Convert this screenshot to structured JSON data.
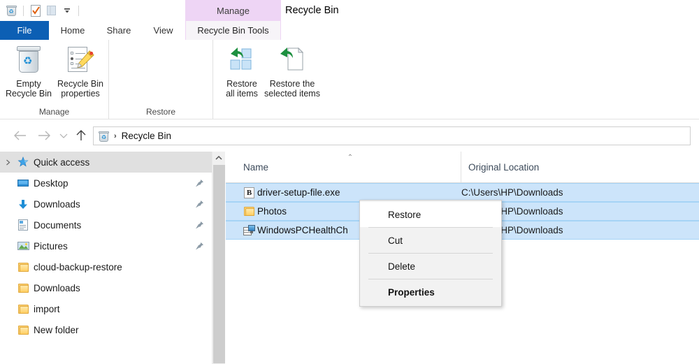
{
  "window": {
    "title": "Recycle Bin",
    "contextual_tab_group": "Manage"
  },
  "quick_access_toolbar": {
    "items": [
      {
        "name": "recycle-bin-icon",
        "label": "Recycle Bin"
      },
      {
        "name": "properties-icon",
        "label": "Properties"
      },
      {
        "name": "new-folder-icon",
        "label": "New folder"
      },
      {
        "name": "customize-dropdown-icon",
        "label": "Customize Quick Access Toolbar"
      }
    ]
  },
  "ribbon": {
    "tabs": [
      {
        "id": "file",
        "label": "File"
      },
      {
        "id": "home",
        "label": "Home"
      },
      {
        "id": "share",
        "label": "Share"
      },
      {
        "id": "view",
        "label": "View"
      },
      {
        "id": "recycle-bin-tools",
        "label": "Recycle Bin Tools"
      }
    ],
    "active_tab": "Recycle Bin Tools",
    "groups": [
      {
        "id": "manage",
        "label": "Manage",
        "buttons": [
          {
            "id": "empty-recycle-bin",
            "line1": "Empty",
            "line2": "Recycle Bin",
            "icon": "recycle-bin-icon"
          },
          {
            "id": "recycle-bin-properties",
            "line1": "Recycle Bin",
            "line2": "properties",
            "icon": "document-pencil-icon"
          }
        ]
      },
      {
        "id": "restore",
        "label": "Restore",
        "buttons": [
          {
            "id": "restore-all-items",
            "line1": "Restore",
            "line2": "all items",
            "icon": "restore-all-icon"
          },
          {
            "id": "restore-selected-items",
            "line1": "Restore the",
            "line2": "selected items",
            "icon": "restore-selected-icon"
          }
        ]
      }
    ]
  },
  "navigation": {
    "back_label": "Back",
    "forward_label": "Forward",
    "recent_label": "Recent locations",
    "up_label": "Up to Desktop",
    "address": {
      "icon": "recycle-bin-icon",
      "separator": "›",
      "crumb": "Recycle Bin"
    }
  },
  "sidebar": {
    "items": [
      {
        "label": "Quick access",
        "icon": "star-pin-icon",
        "selected": true,
        "indent": false,
        "pinned": false
      },
      {
        "label": "Desktop",
        "icon": "desktop-icon",
        "selected": false,
        "indent": true,
        "pinned": true
      },
      {
        "label": "Downloads",
        "icon": "download-icon",
        "selected": false,
        "indent": true,
        "pinned": true
      },
      {
        "label": "Documents",
        "icon": "documents-icon",
        "selected": false,
        "indent": true,
        "pinned": true
      },
      {
        "label": "Pictures",
        "icon": "pictures-icon",
        "selected": false,
        "indent": true,
        "pinned": true
      },
      {
        "label": "cloud-backup-restore",
        "icon": "folder-icon",
        "selected": false,
        "indent": true,
        "pinned": false
      },
      {
        "label": "Downloads",
        "icon": "folder-icon",
        "selected": false,
        "indent": true,
        "pinned": false
      },
      {
        "label": "import",
        "icon": "folder-icon",
        "selected": false,
        "indent": true,
        "pinned": false
      },
      {
        "label": "New folder",
        "icon": "folder-icon",
        "selected": false,
        "indent": true,
        "pinned": false
      }
    ]
  },
  "file_list": {
    "columns": [
      {
        "id": "name",
        "label": "Name",
        "sorted": "ascending",
        "sort_glyph": "⌃"
      },
      {
        "id": "original_location",
        "label": "Original Location",
        "sorted": "none"
      }
    ],
    "rows": [
      {
        "name": "driver-setup-file.exe",
        "original_location": "C:\\Users\\HP\\Downloads",
        "icon": "exe-file-icon",
        "selected": true
      },
      {
        "name": "Photos",
        "original_location": "C:\\Users\\HP\\Downloads",
        "icon": "folder-icon",
        "selected": true
      },
      {
        "name": "WindowsPCHealthCh",
        "original_location": "C:\\Users\\HP\\Downloads",
        "icon": "msi-installer-icon",
        "selected": true
      }
    ]
  },
  "context_menu": {
    "items": [
      {
        "label": "Restore",
        "bold": false,
        "hovered": true
      },
      {
        "label": "Cut",
        "bold": false,
        "hovered": false
      },
      {
        "label": "Delete",
        "bold": false,
        "hovered": false
      },
      {
        "label": "Properties",
        "bold": true,
        "hovered": false
      }
    ]
  },
  "colors": {
    "file_tab_blue": "#0c5fb4",
    "contextual_purple": "#eed5f5",
    "selection_blue": "#cce4fa",
    "selection_border": "#a5d3f5",
    "menu_background": "#f2f2f2"
  }
}
